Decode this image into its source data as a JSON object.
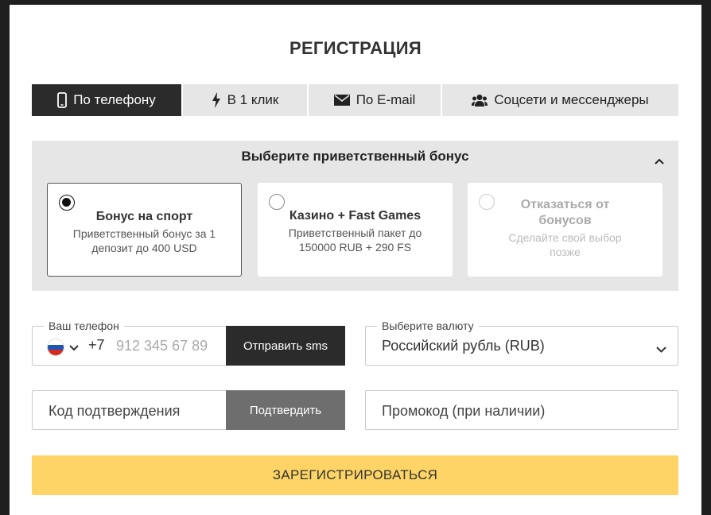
{
  "title": "РЕГИСТРАЦИЯ",
  "tabs": [
    {
      "label": "По телефону",
      "icon": "phone-icon",
      "active": true
    },
    {
      "label": "В 1 клик",
      "icon": "lightning-icon",
      "active": false
    },
    {
      "label": "По E-mail",
      "icon": "envelope-icon",
      "active": false
    },
    {
      "label": "Соцсети и мессенджеры",
      "icon": "users-icon",
      "active": false
    }
  ],
  "bonus": {
    "heading": "Выберите приветственный бонус",
    "options": [
      {
        "title": "Бонус на спорт",
        "desc": "Приветственный бонус за 1 депозит до 400 USD",
        "selected": true
      },
      {
        "title": "Казино + Fast Games",
        "desc": "Приветственный пакет до 150000 RUB + 290 FS",
        "selected": false
      },
      {
        "title": "Отказаться от бонусов",
        "desc": "Сделайте свой выбор позже",
        "selected": false,
        "disabled": true
      }
    ]
  },
  "phone": {
    "label": "Ваш телефон",
    "country_flag": "flag-russia-icon",
    "prefix": "+7",
    "placeholder": "912 345 67 89",
    "sms_button": "Отправить sms"
  },
  "currency": {
    "label": "Выберите валюту",
    "value": "Российский рубль (RUB)"
  },
  "code": {
    "placeholder": "Код подтверждения",
    "confirm_button": "Подтвердить"
  },
  "promo": {
    "placeholder": "Промокод (при наличии)"
  },
  "register_button": "ЗАРЕГИСТРИРОВАТЬСЯ",
  "colors": {
    "active_tab": "#2b2b2b",
    "register_accent": "#fdd465",
    "panel_bg": "#e6e6e6"
  }
}
